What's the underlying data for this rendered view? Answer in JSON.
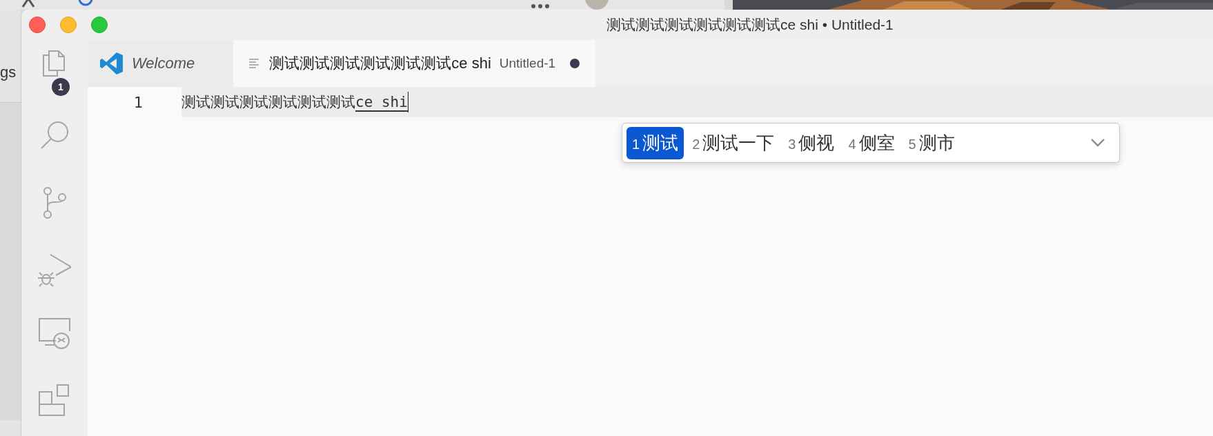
{
  "desktop": {
    "side_text": "gs"
  },
  "window": {
    "title": "测试测试测试测试测试测试ce shi • Untitled-1"
  },
  "activity_bar": {
    "items": [
      {
        "kind": "files",
        "badge": "1"
      },
      {
        "kind": "search"
      },
      {
        "kind": "branch"
      },
      {
        "kind": "debug"
      },
      {
        "kind": "remote"
      },
      {
        "kind": "extensions"
      }
    ]
  },
  "tabs": [
    {
      "kind": "welcome",
      "label": "Welcome",
      "selected": false
    },
    {
      "kind": "text",
      "label": "测试测试测试测试测试测试ce shi",
      "description": "Untitled-1",
      "dirty": true,
      "selected": true
    }
  ],
  "editor": {
    "lines": [
      {
        "number": "1",
        "text": "测试测试测试测试测试测试",
        "composing": "ce shi"
      }
    ]
  },
  "ime": {
    "candidates": [
      {
        "index": "1",
        "text": "测试",
        "selected": true
      },
      {
        "index": "2",
        "text": "测试一下",
        "selected": false
      },
      {
        "index": "3",
        "text": "侧视",
        "selected": false
      },
      {
        "index": "4",
        "text": "侧室",
        "selected": false
      },
      {
        "index": "5",
        "text": "测市",
        "selected": false
      }
    ]
  }
}
